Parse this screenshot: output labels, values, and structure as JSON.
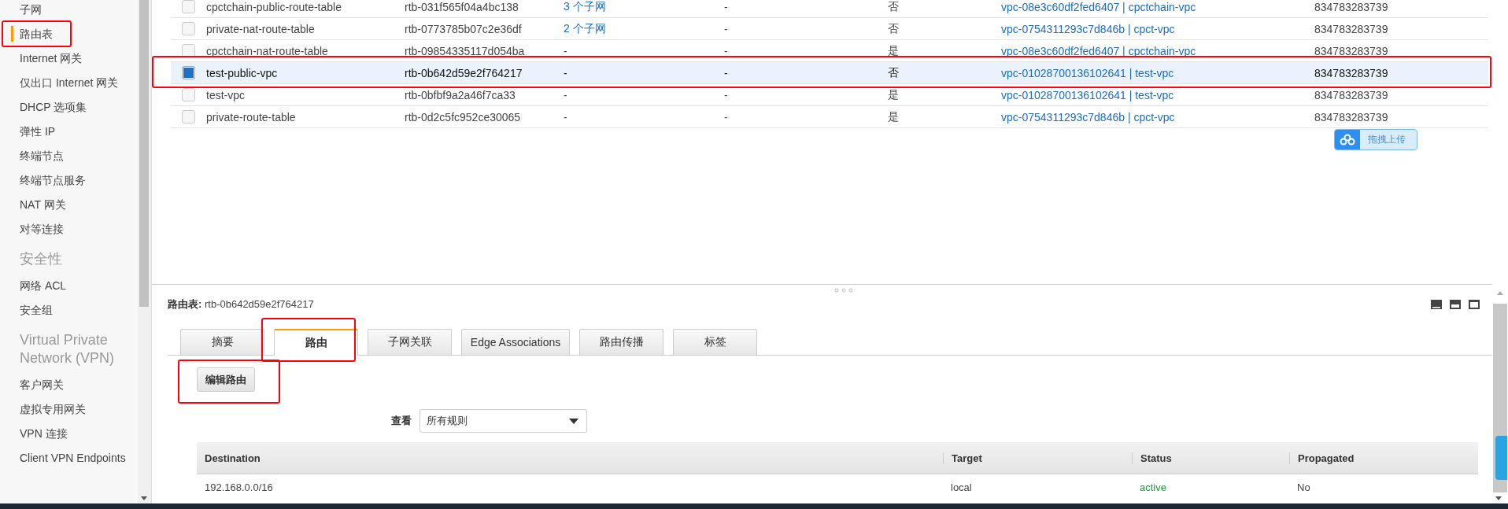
{
  "sidebar": {
    "groups": [
      {
        "items": [
          {
            "label": "子网",
            "selected": false,
            "annotated": false
          },
          {
            "label": "路由表",
            "selected": true,
            "annotated": true
          },
          {
            "label": "Internet 网关",
            "selected": false,
            "annotated": false
          },
          {
            "label": "仅出口 Internet 网关",
            "selected": false,
            "annotated": false
          },
          {
            "label": "DHCP 选项集",
            "selected": false,
            "annotated": false
          },
          {
            "label": "弹性 IP",
            "selected": false,
            "annotated": false
          },
          {
            "label": "终端节点",
            "selected": false,
            "annotated": false
          },
          {
            "label": "终端节点服务",
            "selected": false,
            "annotated": false
          },
          {
            "label": "NAT 网关",
            "selected": false,
            "annotated": false
          },
          {
            "label": "对等连接",
            "selected": false,
            "annotated": false
          }
        ]
      },
      {
        "heading": "安全性",
        "items": [
          {
            "label": "网络 ACL",
            "selected": false,
            "annotated": false
          },
          {
            "label": "安全组",
            "selected": false,
            "annotated": false
          }
        ]
      },
      {
        "heading": "Virtual Private Network (VPN)",
        "items": [
          {
            "label": "客户网关",
            "selected": false,
            "annotated": false
          },
          {
            "label": "虚拟专用网关",
            "selected": false,
            "annotated": false
          },
          {
            "label": "VPN 连接",
            "selected": false,
            "annotated": false
          },
          {
            "label": "Client VPN Endpoints",
            "selected": false,
            "annotated": false
          }
        ]
      }
    ]
  },
  "route_tables": {
    "rows": [
      {
        "name": "cpctchain-public-route-table",
        "id": "rtb-031f565f04a4bc138",
        "subnets": {
          "text": "3 个子网",
          "kind": "link"
        },
        "column_4": "-",
        "main": "否",
        "vpc": "vpc-08e3c60df2fed6407 | cpctchain-vpc",
        "owner": "834783283739",
        "selected": false,
        "annotated": false
      },
      {
        "name": "private-nat-route-table",
        "id": "rtb-0773785b07c2e36df",
        "subnets": {
          "text": "2 个子网",
          "kind": "link"
        },
        "column_4": "-",
        "main": "否",
        "vpc": "vpc-0754311293c7d846b | cpct-vpc",
        "owner": "834783283739",
        "selected": false,
        "annotated": false
      },
      {
        "name": "cpctchain-nat-route-table",
        "id": "rtb-09854335117d054ba",
        "subnets": {
          "text": "-",
          "kind": "plain"
        },
        "column_4": "-",
        "main": "是",
        "vpc": "vpc-08e3c60df2fed6407 | cpctchain-vpc",
        "owner": "834783283739",
        "selected": false,
        "annotated": false
      },
      {
        "name": "test-public-vpc",
        "id": "rtb-0b642d59e2f764217",
        "subnets": {
          "text": "-",
          "kind": "plain"
        },
        "column_4": "-",
        "main": "否",
        "vpc": "vpc-01028700136102641 | test-vpc",
        "owner": "834783283739",
        "selected": true,
        "annotated": true
      },
      {
        "name": "test-vpc",
        "id": "rtb-0bfbf9a2a46f7ca33",
        "subnets": {
          "text": "-",
          "kind": "plain"
        },
        "column_4": "-",
        "main": "是",
        "vpc": "vpc-01028700136102641 | test-vpc",
        "owner": "834783283739",
        "selected": false,
        "annotated": false
      },
      {
        "name": "private-route-table",
        "id": "rtb-0d2c5fc952ce30065",
        "subnets": {
          "text": "-",
          "kind": "plain"
        },
        "column_4": "-",
        "main": "是",
        "vpc": "vpc-0754311293c7d846b | cpct-vpc",
        "owner": "834783283739",
        "selected": false,
        "annotated": false
      }
    ]
  },
  "upload_button": {
    "label": "拖拽上传"
  },
  "details": {
    "title_label": "路由表:",
    "title_value": "rtb-0b642d59e2f764217",
    "tabs": [
      {
        "label": "摘要",
        "selected": false,
        "annotated": false
      },
      {
        "label": "路由",
        "selected": true,
        "annotated": true
      },
      {
        "label": "子网关联",
        "selected": false,
        "annotated": false
      },
      {
        "label": "Edge Associations",
        "selected": false,
        "annotated": false
      },
      {
        "label": "路由传播",
        "selected": false,
        "annotated": false
      },
      {
        "label": "标签",
        "selected": false,
        "annotated": false
      }
    ],
    "edit_button": {
      "label": "编辑路由",
      "annotated": true
    },
    "filter": {
      "label": "查看",
      "value": "所有规则"
    },
    "routes": {
      "columns": [
        "Destination",
        "Target",
        "Status",
        "Propagated"
      ],
      "rows": [
        {
          "destination": "192.168.0.0/16",
          "target": "local",
          "status": "active",
          "propagated": "No"
        }
      ]
    }
  }
}
